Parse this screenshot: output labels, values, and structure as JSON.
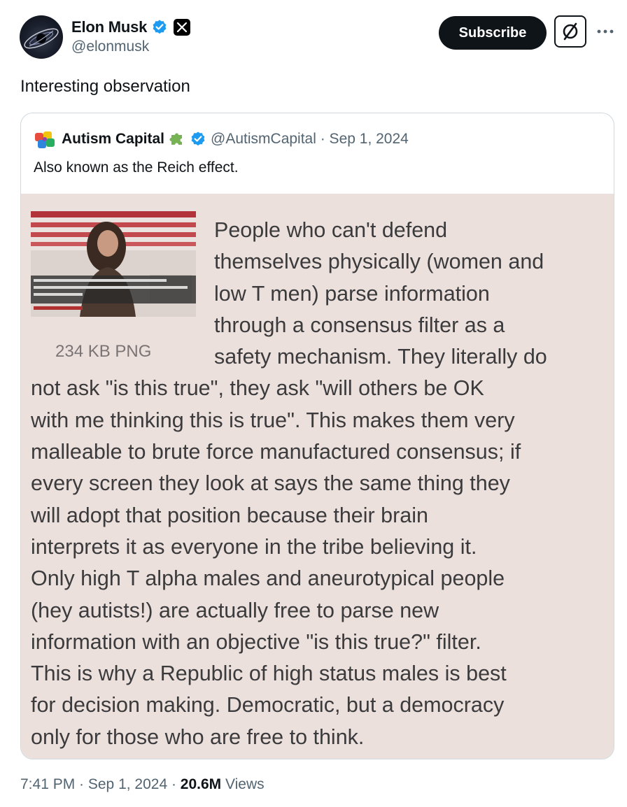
{
  "author": {
    "display_name": "Elon Musk",
    "handle": "@elonmusk"
  },
  "header": {
    "subscribe_label": "Subscribe",
    "more_label": "···"
  },
  "tweet": {
    "text": "Interesting observation"
  },
  "quote": {
    "display_name": "Autism Capital",
    "handle_date": "@AutismCapital · Sep 1, 2024",
    "text": "Also known as the Reich effect.",
    "image": {
      "photo_caption": "234 KB PNG",
      "lines": [
        "People who can't defend",
        "themselves physically (women and",
        "low T men) parse information",
        "through a consensus filter as a",
        "safety mechanism. They literally do",
        "not ask \"is this true\", they ask \"will others be OK",
        "with me thinking this is true\". This makes them very",
        "malleable to brute force manufactured consensus; if",
        "every screen they look at says the same thing they",
        "will adopt that position because their brain",
        "interprets it as everyone in the tribe believing it.",
        "Only high T alpha males and aneurotypical people",
        "(hey autists!) are actually free to parse new",
        "information with an objective \"is this true?\" filter.",
        "This is why a Republic of high status males is best",
        "for decision making. Democratic, but a democracy",
        "only for those who are free to think."
      ]
    }
  },
  "meta": {
    "time_date": "7:41 PM · Sep 1, 2024 · ",
    "views_count": "20.6M",
    "views_label": " Views"
  },
  "colors": {
    "verified": "#1d9bf0",
    "text_primary": "#0f1419",
    "text_secondary": "#536471",
    "card_border": "#cfd9de",
    "image_bg": "#ece0dc"
  },
  "icons": [
    "verified-icon",
    "x-logo-icon",
    "grok-icon",
    "more-icon",
    "puzzle-icon"
  ]
}
